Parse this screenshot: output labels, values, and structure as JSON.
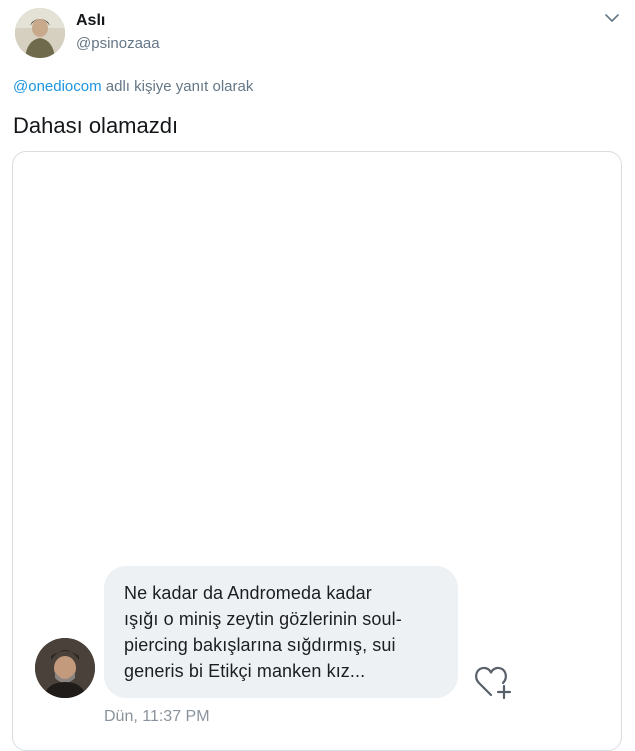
{
  "tweet": {
    "author_name": "Aslı",
    "author_handle": "@psinozaaa",
    "reply_prefix": "@onediocom",
    "reply_suffix": " adlı kişiye yanıt olarak",
    "text": "Dahası olamazdı"
  },
  "dm": {
    "message_lines": [
      "Ne kadar da Andromeda kadar",
      "ışığı o miniş zeytin gözlerinin soul-",
      "piercing bakışlarına sığdırmış, sui",
      "generis bi Etikçi manken kız..."
    ],
    "timestamp": "Dün, 11:37 PM"
  },
  "colors": {
    "link": "#1b95e0",
    "secondary_text": "#657786",
    "bubble_bg": "#eef1f4",
    "border": "#d8dde1"
  },
  "icons": [
    "chevron-down-icon",
    "heart-plus-icon"
  ]
}
